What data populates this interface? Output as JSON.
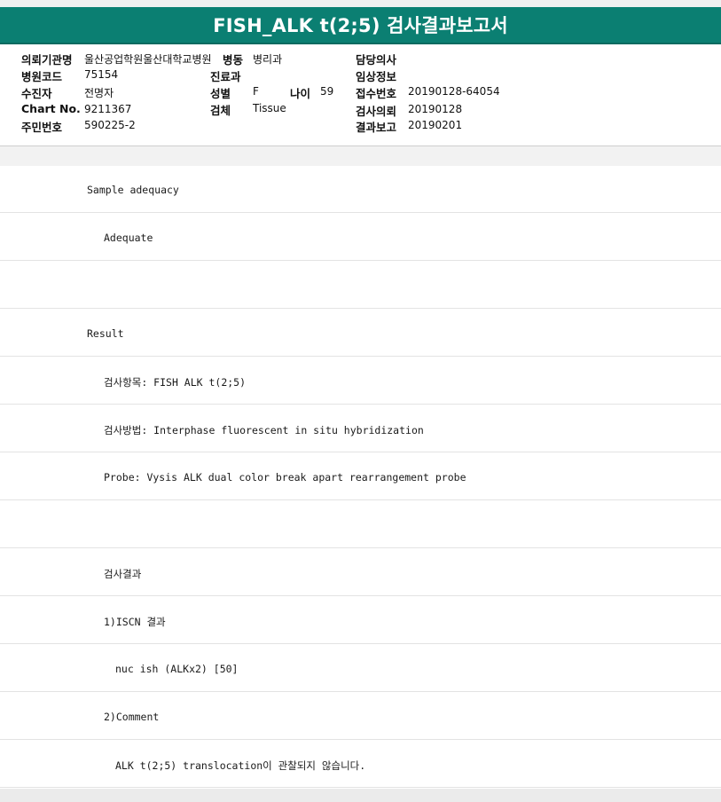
{
  "title": "FISH_ALK t(2;5) 검사결과보고서",
  "info": {
    "institution": {
      "label": "의뢰기관명",
      "value": "울산공업학원울산대학교병원"
    },
    "ward": {
      "label": "병동",
      "value": "병리과"
    },
    "doctor": {
      "label": "담당의사",
      "value": ""
    },
    "hospital_code": {
      "label": "병원코드",
      "value": "75154"
    },
    "department": {
      "label": "진료과",
      "value": ""
    },
    "clinical_info": {
      "label": "임상정보",
      "value": ""
    },
    "collector": {
      "label": "수진자",
      "value": "전명자"
    },
    "sex": {
      "label": "성별",
      "value": "F"
    },
    "age": {
      "label": "나이",
      "value": "59"
    },
    "receipt_no": {
      "label": "접수번호",
      "value": "20190128-64054"
    },
    "chart_no": {
      "label": "Chart No.",
      "value": "9211367"
    },
    "specimen": {
      "label": "검체",
      "value": "Tissue"
    },
    "request_date": {
      "label": "검사의뢰",
      "value": "20190128"
    },
    "resident_no": {
      "label": "주민번호",
      "value": "590225-2"
    },
    "report_date": {
      "label": "결과보고",
      "value": "20190201"
    }
  },
  "report_lines": [
    "Sample adequacy",
    "Adequate",
    "",
    "Result",
    "검사항목: FISH ALK t(2;5)",
    "검사방법: Interphase fluorescent in situ hybridization",
    "Probe: Vysis ALK dual color break apart rearrangement probe",
    "",
    "검사결과",
    "1)ISCN 결과",
    "nuc ish (ALKx2) [50]",
    "2)Comment",
    "ALK t(2;5) translocation이 관찰되지 않습니다."
  ]
}
